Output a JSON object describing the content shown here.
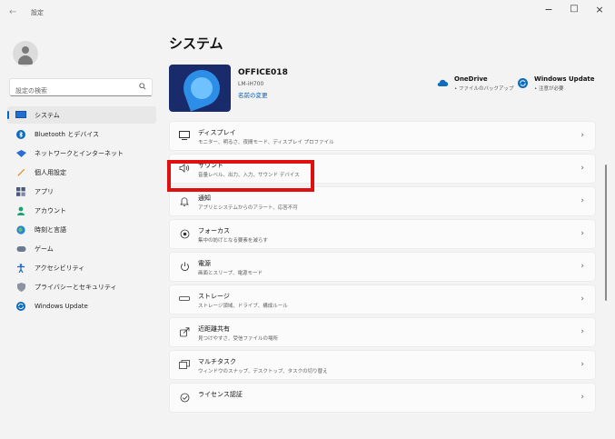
{
  "window": {
    "title": "設定",
    "back_glyph": "←",
    "controls": {
      "minimize": "−",
      "maximize": "□",
      "close": "×"
    }
  },
  "sidebar": {
    "search_placeholder": "設定の検索",
    "items": [
      {
        "label": "システム",
        "icon": "system-icon",
        "active": true
      },
      {
        "label": "Bluetooth とデバイス",
        "icon": "bluetooth-icon"
      },
      {
        "label": "ネットワークとインターネット",
        "icon": "network-icon"
      },
      {
        "label": "個人用設定",
        "icon": "personalization-icon"
      },
      {
        "label": "アプリ",
        "icon": "apps-icon"
      },
      {
        "label": "アカウント",
        "icon": "accounts-icon"
      },
      {
        "label": "時刻と言語",
        "icon": "time-language-icon"
      },
      {
        "label": "ゲーム",
        "icon": "gaming-icon"
      },
      {
        "label": "アクセシビリティ",
        "icon": "accessibility-icon"
      },
      {
        "label": "プライバシーとセキュリティ",
        "icon": "privacy-icon"
      },
      {
        "label": "Windows Update",
        "icon": "windows-update-icon"
      }
    ]
  },
  "main": {
    "title": "システム",
    "device": {
      "name": "OFFICE018",
      "model": "LM-iH700",
      "rename_link": "名前の変更"
    },
    "actions": {
      "onedrive": {
        "title": "OneDrive",
        "subtitle": "• ファイルのバックアップ"
      },
      "windows_update": {
        "title": "Windows Update",
        "subtitle": "• 注意が必要"
      }
    },
    "rows": [
      {
        "title": "ディスプレイ",
        "subtitle": "モニター、明るさ、夜間モード、ディスプレイ プロファイル",
        "icon": "display-icon"
      },
      {
        "title": "サウンド",
        "subtitle": "音量レベル、出力、入力、サウンド デバイス",
        "icon": "sound-icon"
      },
      {
        "title": "通知",
        "subtitle": "アプリとシステムからのアラート、応答不可",
        "icon": "notifications-icon"
      },
      {
        "title": "フォーカス",
        "subtitle": "集中の妨げとなる要素を減らす",
        "icon": "focus-icon"
      },
      {
        "title": "電源",
        "subtitle": "画面とスリープ、電源モード",
        "icon": "power-icon"
      },
      {
        "title": "ストレージ",
        "subtitle": "ストレージ領域、ドライブ、構成ルール",
        "icon": "storage-icon"
      },
      {
        "title": "近距離共有",
        "subtitle": "見つけやすさ、受信ファイルの場所",
        "icon": "nearby-sharing-icon"
      },
      {
        "title": "マルチタスク",
        "subtitle": "ウィンドウのスナップ、デスクトップ、タスクの切り替え",
        "icon": "multitasking-icon"
      },
      {
        "title": "ライセンス認証",
        "subtitle": "",
        "icon": "activation-icon"
      }
    ]
  },
  "colors": {
    "accent": "#0067c0",
    "highlight": "#e01010"
  }
}
